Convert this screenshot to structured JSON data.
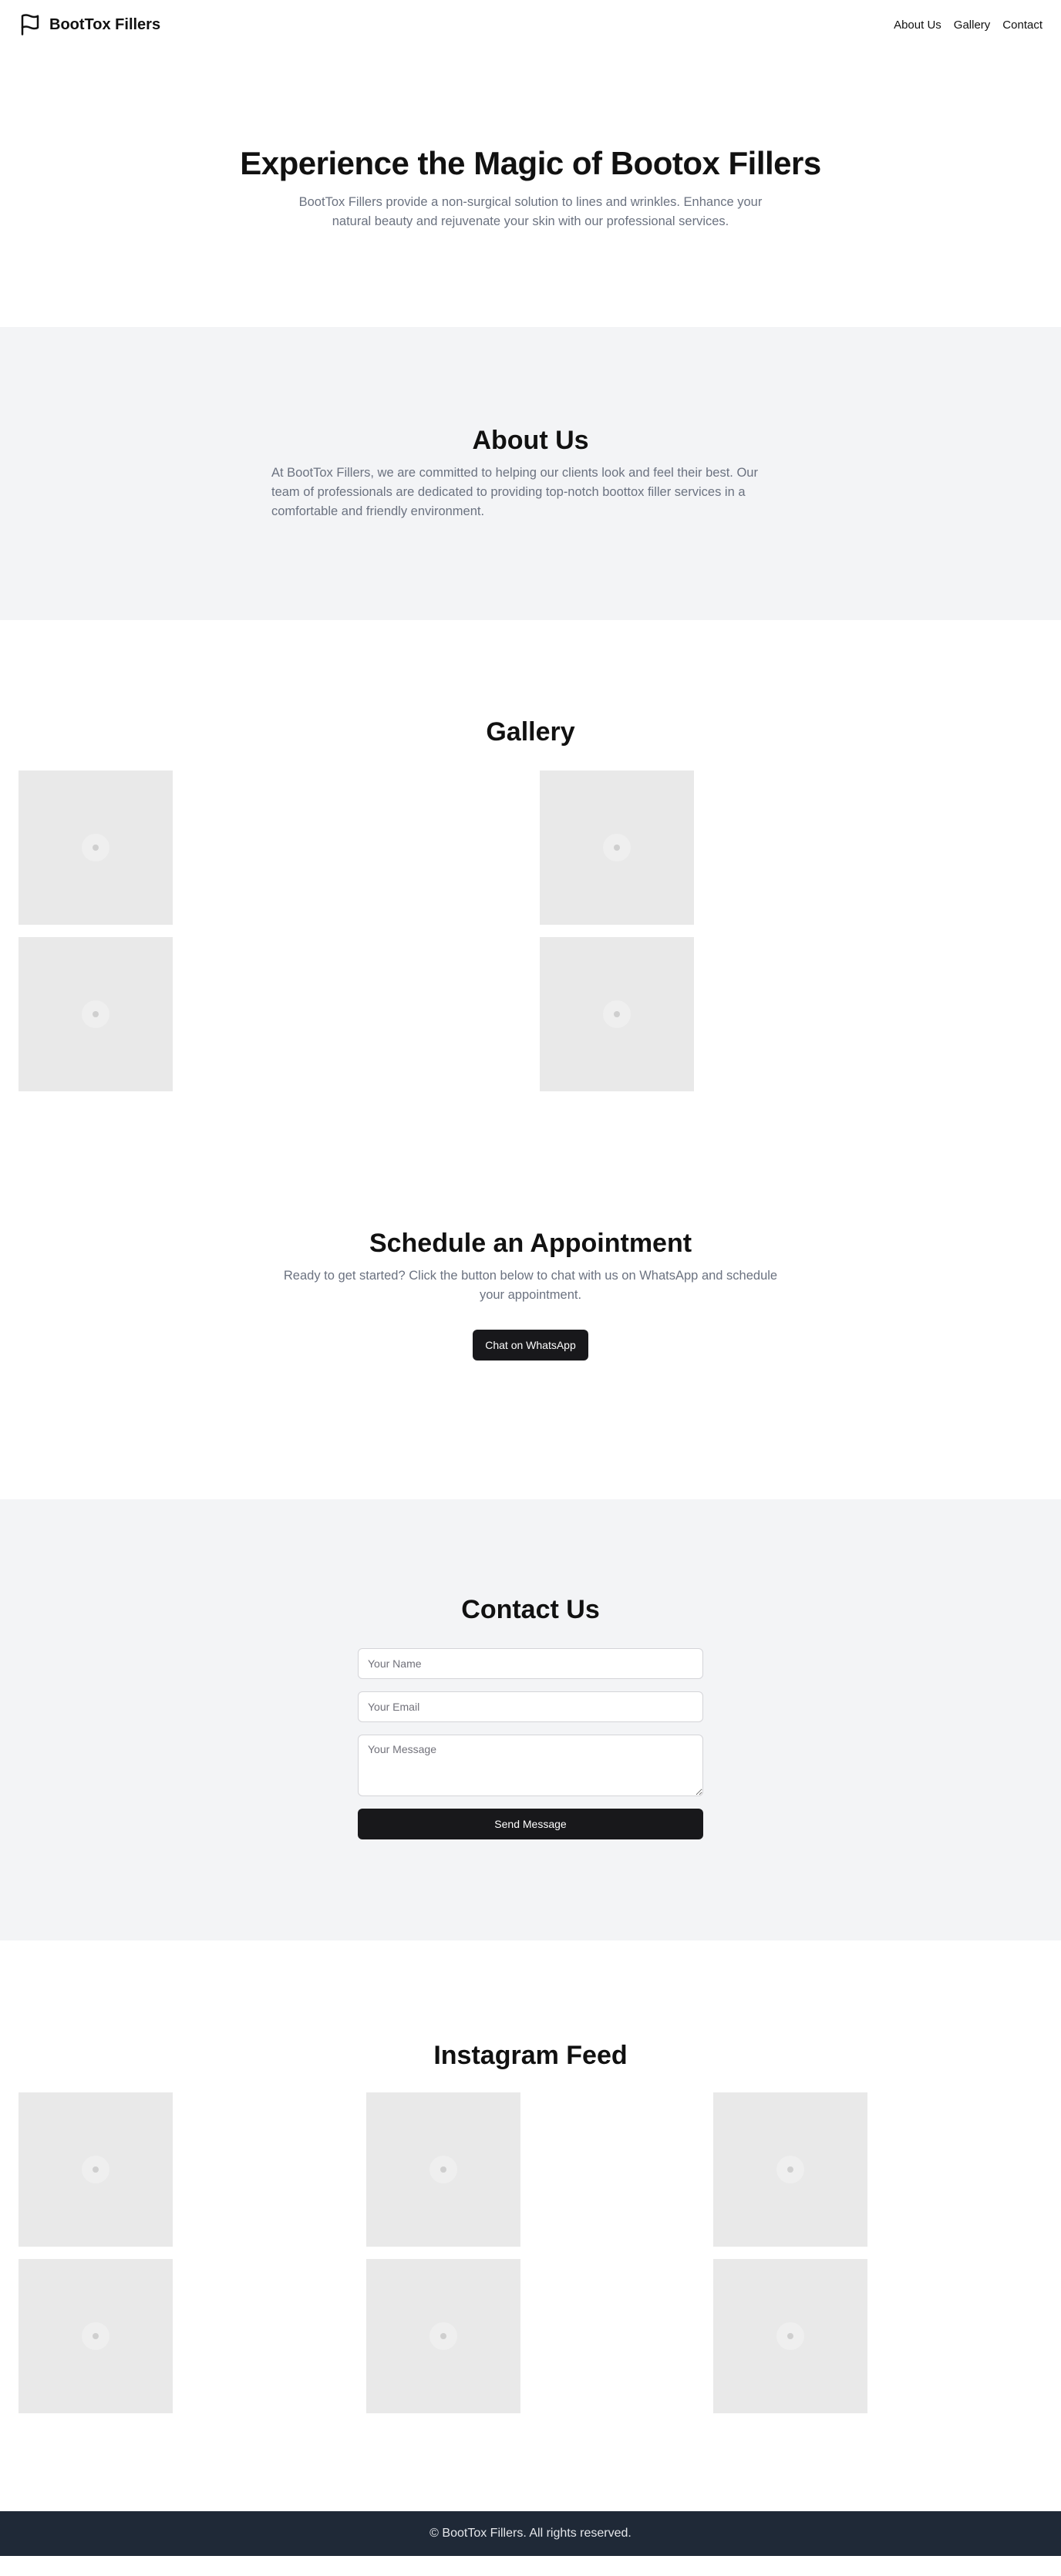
{
  "header": {
    "brand_name": "BootTox Fillers",
    "nav": [
      "About Us",
      "Gallery",
      "Contact"
    ]
  },
  "hero": {
    "title": "Experience the Magic of Bootox Fillers",
    "subtitle": "BootTox Fillers provide a non-surgical solution to lines and wrinkles. Enhance your natural beauty and rejuvenate your skin with our professional services."
  },
  "about": {
    "title": "About Us",
    "body": "At BootTox Fillers, we are committed to helping our clients look and feel their best. Our team of professionals are dedicated to providing top-notch boottox filler services in a comfortable and friendly environment."
  },
  "gallery": {
    "title": "Gallery",
    "images": [
      "image-placeholder",
      "image-placeholder",
      "image-placeholder",
      "image-placeholder"
    ]
  },
  "schedule": {
    "title": "Schedule an Appointment",
    "body": "Ready to get started? Click the button below to chat with us on WhatsApp and schedule your appointment.",
    "button_label": "Chat on WhatsApp"
  },
  "contact": {
    "title": "Contact Us",
    "name_placeholder": "Your Name",
    "email_placeholder": "Your Email",
    "message_placeholder": "Your Message",
    "submit_label": "Send Message"
  },
  "instagram": {
    "title": "Instagram Feed",
    "images": [
      "image-placeholder",
      "image-placeholder",
      "image-placeholder",
      "image-placeholder",
      "image-placeholder",
      "image-placeholder"
    ]
  },
  "footer": {
    "text": "© BootTox Fillers. All rights reserved."
  },
  "colors": {
    "dark_button": "#18181b",
    "muted_text": "#6b7280",
    "section_gray": "#f3f4f6",
    "footer_bg": "#1f2937",
    "placeholder_bg": "#e9e9e9"
  }
}
